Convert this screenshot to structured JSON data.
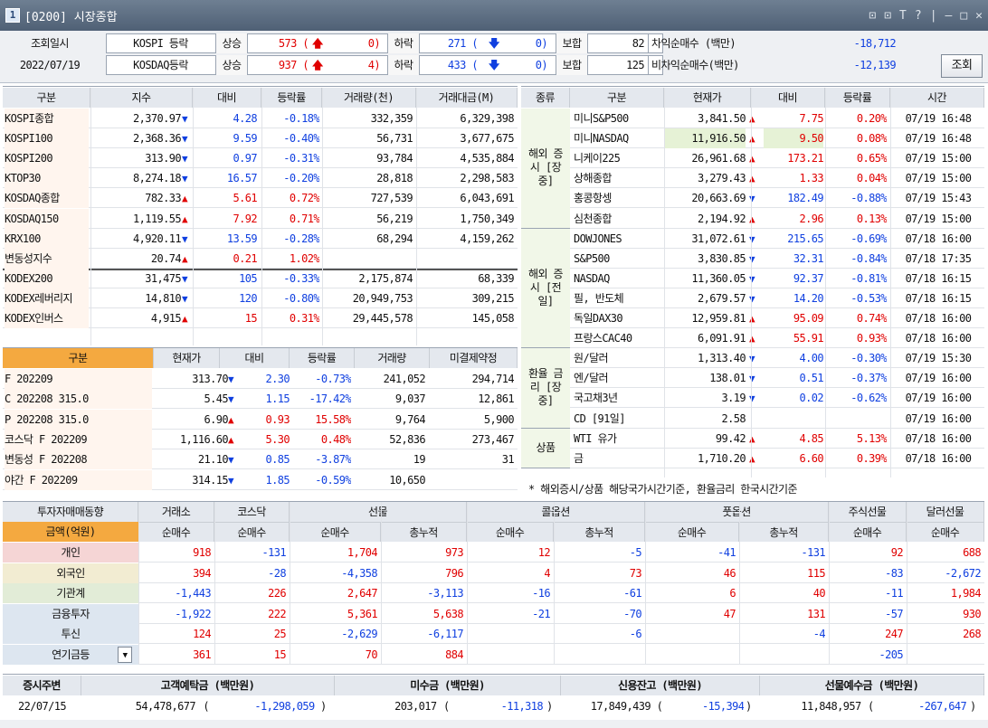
{
  "window": {
    "num": "1",
    "title": "[0200] 시장종합",
    "ctrl_icons": [
      "⊡",
      "⊡",
      "T",
      "?",
      "|",
      "—",
      "□",
      "✕"
    ]
  },
  "top": {
    "date_label": "조회일시",
    "date": "2022/07/19",
    "button": "조회",
    "rows": [
      {
        "market": "KOSPI 등락",
        "up_label": "상승",
        "up": "573 (",
        "up2": "0)",
        "dn_label": "하락",
        "dn": "271 (",
        "dn2": "0)",
        "flat_label": "보합",
        "flat": "82",
        "prog_label": "차익순매수 (백만)",
        "prog": "-18,712"
      },
      {
        "market": "KOSDAQ등락",
        "up_label": "상승",
        "up": "937 (",
        "up2": "4)",
        "dn_label": "하락",
        "dn": "433 (",
        "dn2": "0)",
        "flat_label": "보합",
        "flat": "125",
        "prog_label": "비차익순매수(백만)",
        "prog": "-12,139"
      }
    ]
  },
  "index": {
    "headers": [
      "구분",
      "지수",
      "대비",
      "등락률",
      "거래량(천)",
      "거래대금(M)"
    ],
    "rows": [
      [
        "KOSPI종합",
        "2,370.97",
        "dn",
        "4.28",
        "-0.18%",
        "332,359",
        "6,329,398"
      ],
      [
        "KOSPI100",
        "2,368.36",
        "dn",
        "9.59",
        "-0.40%",
        "56,731",
        "3,677,675"
      ],
      [
        "KOSPI200",
        "313.90",
        "dn",
        "0.97",
        "-0.31%",
        "93,784",
        "4,535,884"
      ],
      [
        "KTOP30",
        "8,274.18",
        "dn",
        "16.57",
        "-0.20%",
        "28,818",
        "2,298,583"
      ],
      [
        "KOSDAQ종합",
        "782.33",
        "up",
        "5.61",
        "0.72%",
        "727,539",
        "6,043,691"
      ],
      [
        "KOSDAQ150",
        "1,119.55",
        "up",
        "7.92",
        "0.71%",
        "56,219",
        "1,750,349"
      ],
      [
        "KRX100",
        "4,920.11",
        "dn",
        "13.59",
        "-0.28%",
        "68,294",
        "4,159,262"
      ],
      [
        "변동성지수",
        "20.74",
        "up",
        "0.21",
        "1.02%",
        "",
        ""
      ],
      [
        "KODEX200",
        "31,475",
        "dn",
        "105",
        "-0.33%",
        "2,175,874",
        "68,339"
      ],
      [
        "KODEX레버리지",
        "14,810",
        "dn",
        "120",
        "-0.80%",
        "20,949,753",
        "309,215"
      ],
      [
        "KODEX인버스",
        "4,915",
        "up",
        "15",
        "0.31%",
        "29,445,578",
        "145,058"
      ]
    ]
  },
  "futures": {
    "headers": [
      "구분",
      "현재가",
      "대비",
      "등락률",
      "거래량",
      "미결제약정"
    ],
    "rows": [
      [
        "F 202209",
        "313.70",
        "dn",
        "2.30",
        "-0.73%",
        "241,052",
        "294,714"
      ],
      [
        "C 202208 315.0",
        "5.45",
        "dn",
        "1.15",
        "-17.42%",
        "9,037",
        "12,861"
      ],
      [
        "P 202208 315.0",
        "6.90",
        "up",
        "0.93",
        "15.58%",
        "9,764",
        "5,900"
      ],
      [
        "코스닥 F 202209",
        "1,116.60",
        "up",
        "5.30",
        "0.48%",
        "52,836",
        "273,467"
      ],
      [
        "변동성 F 202208",
        "21.10",
        "dn",
        "0.85",
        "-3.87%",
        "19",
        "31"
      ],
      [
        "야간 F 202209",
        "314.15",
        "dn",
        "1.85",
        "-0.59%",
        "10,650",
        ""
      ]
    ]
  },
  "world": {
    "headers": [
      "종류",
      "구분",
      "현재가",
      "대비",
      "등락률",
      "시간"
    ],
    "groups": [
      {
        "label": "해외 증시 [장중]",
        "rows": [
          [
            "미니S&P500",
            "3,841.50",
            "up",
            "7.75",
            "0.20%",
            "07/19 16:48"
          ],
          [
            "미니NASDAQ",
            "11,916.50",
            "up",
            "9.50",
            "0.08%",
            "07/19 16:48"
          ],
          [
            "니케이225",
            "26,961.68",
            "up",
            "173.21",
            "0.65%",
            "07/19 15:00"
          ],
          [
            "상해종합",
            "3,279.43",
            "up",
            "1.33",
            "0.04%",
            "07/19 15:00"
          ],
          [
            "홍콩항셍",
            "20,663.69",
            "dn",
            "182.49",
            "-0.88%",
            "07/19 15:43"
          ],
          [
            "심천종합",
            "2,194.92",
            "up",
            "2.96",
            "0.13%",
            "07/19 15:00"
          ]
        ]
      },
      {
        "label": "해외 증시 [전일]",
        "rows": [
          [
            "DOWJONES",
            "31,072.61",
            "dn",
            "215.65",
            "-0.69%",
            "07/18 16:00"
          ],
          [
            "S&P500",
            "3,830.85",
            "dn",
            "32.31",
            "-0.84%",
            "07/18 17:35"
          ],
          [
            "NASDAQ",
            "11,360.05",
            "dn",
            "92.37",
            "-0.81%",
            "07/18 16:15"
          ],
          [
            "필, 반도체",
            "2,679.57",
            "dn",
            "14.20",
            "-0.53%",
            "07/18 16:15"
          ],
          [
            "독일DAX30",
            "12,959.81",
            "up",
            "95.09",
            "0.74%",
            "07/18 16:00"
          ],
          [
            "프랑스CAC40",
            "6,091.91",
            "up",
            "55.91",
            "0.93%",
            "07/18 16:00"
          ]
        ]
      },
      {
        "label": "환율 금리 [장중]",
        "rows": [
          [
            "원/달러",
            "1,313.40",
            "dn",
            "4.00",
            "-0.30%",
            "07/19 15:30"
          ],
          [
            "엔/달러",
            "138.01",
            "dn",
            "0.51",
            "-0.37%",
            "07/19 16:00"
          ],
          [
            "국고채3년",
            "3.19",
            "dn",
            "0.02",
            "-0.62%",
            "07/19 16:00"
          ],
          [
            "CD [91일]",
            "2.58",
            "",
            "",
            "",
            "07/19 16:00"
          ]
        ]
      },
      {
        "label": "상품",
        "rows": [
          [
            "WTI 유가",
            "99.42",
            "up",
            "4.85",
            "5.13%",
            "07/18 16:00"
          ],
          [
            "금",
            "1,710.20",
            "up",
            "6.60",
            "0.39%",
            "07/18 16:00"
          ]
        ]
      }
    ],
    "note": "* 해외증시/상품 해당국가시간기준, 환율금리 한국시간기준"
  },
  "investor": {
    "title": "투자자매매동향",
    "unit": "금액(억원)",
    "groups": [
      "거래소",
      "코스닥",
      "선물",
      "콜옵션",
      "풋옵션",
      "주식선물",
      "달러선물"
    ],
    "subs": [
      "순매수",
      "순매수",
      "순매수",
      "총누적",
      "순매수",
      "총누적",
      "순매수",
      "총누적",
      "순매수",
      "순매수"
    ],
    "rows": [
      {
        "name": "개인",
        "vals": [
          "918",
          "-131",
          "1,704",
          "973",
          "12",
          "-5",
          "-41",
          "-131",
          "92",
          "688"
        ]
      },
      {
        "name": "외국인",
        "vals": [
          "394",
          "-28",
          "-4,358",
          "796",
          "4",
          "73",
          "46",
          "115",
          "-83",
          "-2,672"
        ]
      },
      {
        "name": "기관계",
        "vals": [
          "-1,443",
          "226",
          "2,647",
          "-3,113",
          "-16",
          "-61",
          "6",
          "40",
          "-11",
          "1,984"
        ]
      },
      {
        "name": "금융투자",
        "vals": [
          "-1,922",
          "222",
          "5,361",
          "5,638",
          "-21",
          "-70",
          "47",
          "131",
          "-57",
          "930"
        ]
      },
      {
        "name": "투신",
        "vals": [
          "124",
          "25",
          "-2,629",
          "-6,117",
          "",
          "-6",
          "",
          "-4",
          "247",
          "268"
        ]
      },
      {
        "name": "연기금등",
        "vals": [
          "361",
          "15",
          "70",
          "884",
          "",
          "",
          "",
          "",
          "-205",
          ""
        ]
      }
    ]
  },
  "funds": {
    "headers": [
      "증시주변",
      "고객예탁금 (백만원)",
      "미수금 (백만원)",
      "신용잔고 (백만원)",
      "선물예수금 (백만원)"
    ],
    "date": "22/07/15",
    "vals": [
      [
        "54,478,677",
        "-1,298,059"
      ],
      [
        "203,017",
        "-11,318"
      ],
      [
        "17,849,439",
        "-15,394"
      ],
      [
        "11,848,957",
        "-267,647"
      ]
    ]
  }
}
